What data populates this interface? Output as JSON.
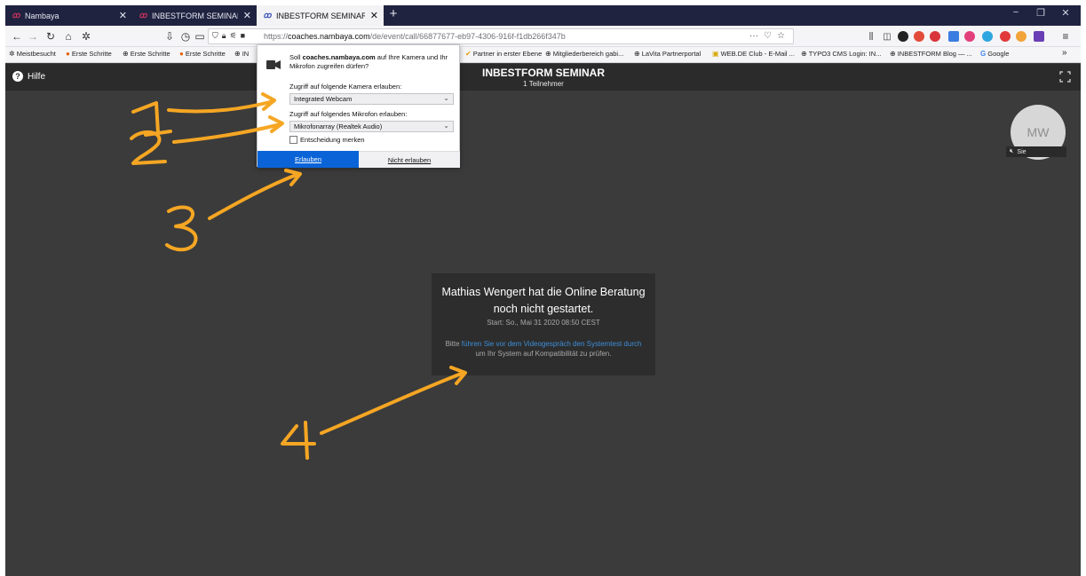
{
  "browser": {
    "tabs": [
      {
        "title": "Nambaya",
        "active": false
      },
      {
        "title": "INBESTFORM SEMINAR | group",
        "active": false
      },
      {
        "title": "INBESTFORM SEMINAR | group",
        "active": true
      }
    ],
    "new_tab": "+",
    "window_controls": {
      "minimize": "−",
      "maximize": "❐",
      "close": "✕"
    },
    "address": {
      "prefix": "https://",
      "host": "coaches.nambaya.com",
      "path": "/de/event/call/66877677-eb97-4306-916f-f1db266f347b"
    },
    "bookmarks": [
      {
        "label": "Meistbesucht",
        "icon": "gear-icon"
      },
      {
        "label": "Erste Schritte",
        "icon": "firefox-icon"
      },
      {
        "label": "Erste Schritte",
        "icon": "globe-icon"
      },
      {
        "label": "Erste Schritte",
        "icon": "firefox-icon"
      },
      {
        "label": "IN",
        "icon": "globe-icon"
      },
      {
        "label": "Partner in erster Ebene",
        "icon": "check-icon"
      },
      {
        "label": "Mitgliederbereich gabi...",
        "icon": "globe-icon"
      },
      {
        "label": "LaVita Partnerportal",
        "icon": "globe-icon"
      },
      {
        "label": "WEB.DE Club - E-Mail ...",
        "icon": "webde-icon"
      },
      {
        "label": "TYPO3 CMS Login: IN...",
        "icon": "globe-icon"
      },
      {
        "label": "INBESTFORM Blog — ...",
        "icon": "globe-icon"
      },
      {
        "label": "Google",
        "icon": "google-icon"
      }
    ],
    "overflow": "»"
  },
  "page": {
    "help": "Hilfe",
    "title": "INBESTFORM SEMINAR",
    "subtitle": "1 Teilnehmer",
    "avatar_initials": "MW",
    "self_label": "Sie",
    "info": {
      "title_line1": "Mathias Wengert hat die Online Beratung",
      "title_line2": "noch nicht gestartet.",
      "start": "Start: So., Mai 31 2020 08:50 CEST",
      "note_pre": "Bitte ",
      "note_link": "führen Sie vor dem Videogespräch den Systemtest durch",
      "note_post": " um Ihr System auf Kompatibilität zu prüfen."
    }
  },
  "permission_popup": {
    "question_pre": "Soll ",
    "question_host": "coaches.nambaya.com",
    "question_post": " auf Ihre Kamera und Ihr Mikrofon zugreifen dürfen?",
    "camera_label": "Zugriff auf folgende Kamera erlauben:",
    "camera_value": "Integrated Webcam",
    "mic_label": "Zugriff auf folgendes Mikrofon erlauben:",
    "mic_value": "Mikrofonarray (Realtek Audio)",
    "remember": "Entscheidung merken",
    "allow": "Erlauben",
    "deny": "Nicht erlauben"
  },
  "annotations": {
    "marker_color": "#f5a623",
    "numbers": [
      "1",
      "2",
      "3",
      "4"
    ]
  }
}
